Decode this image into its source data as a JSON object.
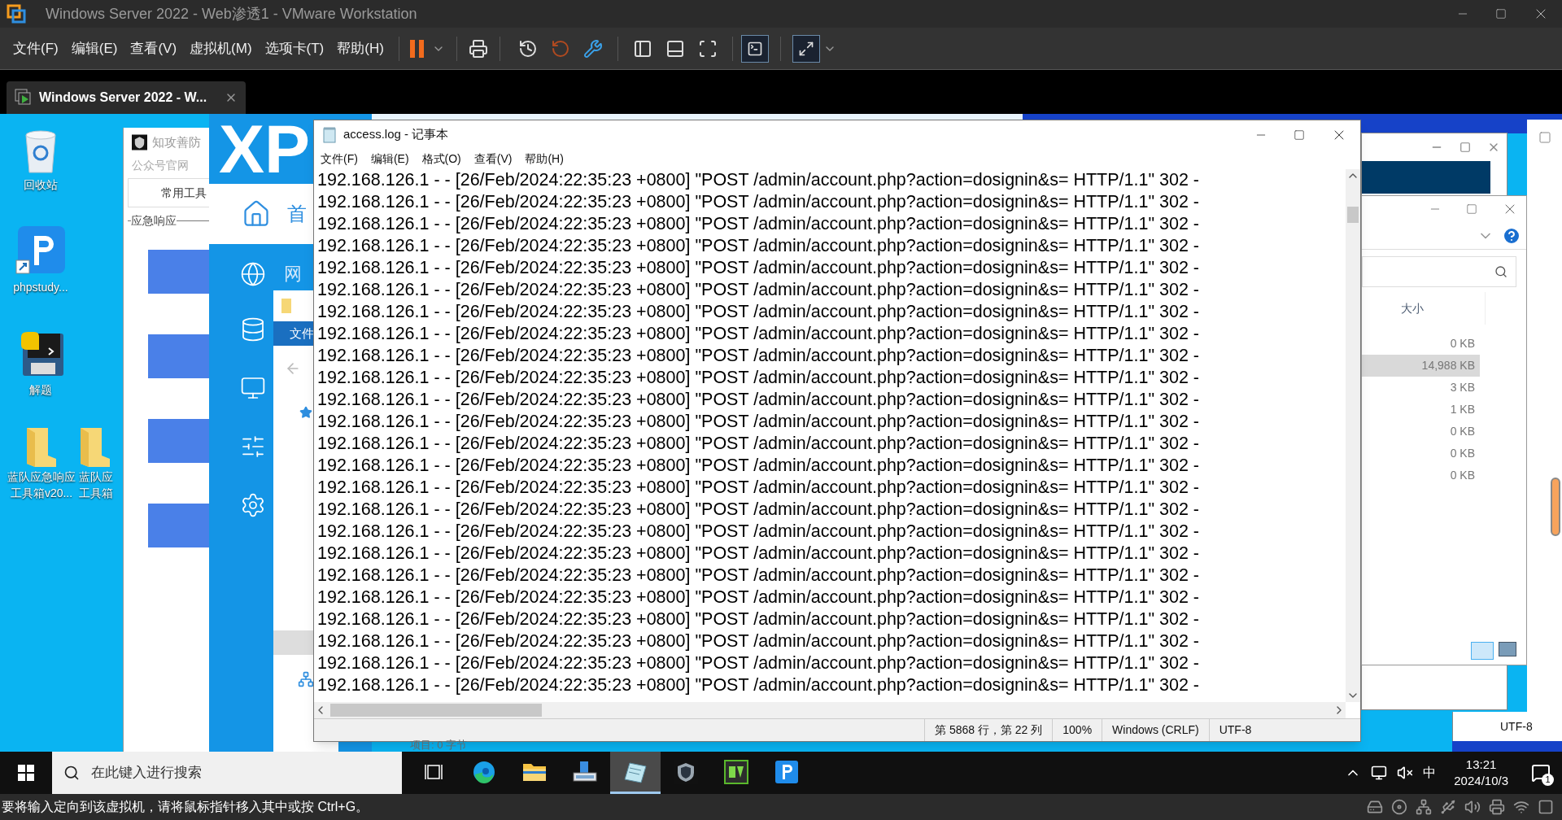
{
  "window": {
    "title": "Windows Server 2022 - Web渗透1 - VMware Workstation"
  },
  "menu": [
    "文件(F)",
    "编辑(E)",
    "查看(V)",
    "虚拟机(M)",
    "选项卡(T)",
    "帮助(H)"
  ],
  "vm_tab": {
    "label": "Windows Server 2022 - W...",
    "selected": true
  },
  "desktop_icons": [
    {
      "kind": "recycle",
      "lines": [
        "回收站"
      ]
    },
    {
      "kind": "phpstudy",
      "lines": [
        "phpstudy..."
      ]
    },
    {
      "kind": "python",
      "lines": [
        "解题"
      ]
    }
  ],
  "desktop_folders": [
    {
      "lines": [
        "蓝队应急响应",
        "工具箱v20..."
      ]
    },
    {
      "lines": [
        "蓝队应",
        "工具箱"
      ]
    }
  ],
  "toolkit_window": {
    "title": "知攻善防",
    "link": "公众号官网",
    "tab": "常用工具",
    "group": "应急响应"
  },
  "xp_window": {
    "logo": "XP",
    "home": "首",
    "nav": "网",
    "ribbon_tab": "文件"
  },
  "notepad": {
    "title": "access.log - 记事本",
    "menu": [
      "文件(F)",
      "编辑(E)",
      "格式(O)",
      "查看(V)",
      "帮助(H)"
    ],
    "lines": [
      "192.168.126.1 - - [26/Feb/2024:22:35:23 +0800] \"POST /admin/account.php?action=dosignin&s= HTTP/1.1\" 302 -",
      "192.168.126.1 - - [26/Feb/2024:22:35:23 +0800] \"POST /admin/account.php?action=dosignin&s= HTTP/1.1\" 302 -",
      "192.168.126.1 - - [26/Feb/2024:22:35:23 +0800] \"POST /admin/account.php?action=dosignin&s= HTTP/1.1\" 302 -",
      "192.168.126.1 - - [26/Feb/2024:22:35:23 +0800] \"POST /admin/account.php?action=dosignin&s= HTTP/1.1\" 302 -",
      "192.168.126.1 - - [26/Feb/2024:22:35:23 +0800] \"POST /admin/account.php?action=dosignin&s= HTTP/1.1\" 302 -",
      "192.168.126.1 - - [26/Feb/2024:22:35:23 +0800] \"POST /admin/account.php?action=dosignin&s= HTTP/1.1\" 302 -",
      "192.168.126.1 - - [26/Feb/2024:22:35:23 +0800] \"POST /admin/account.php?action=dosignin&s= HTTP/1.1\" 302 -",
      "192.168.126.1 - - [26/Feb/2024:22:35:23 +0800] \"POST /admin/account.php?action=dosignin&s= HTTP/1.1\" 302 -",
      "192.168.126.1 - - [26/Feb/2024:22:35:23 +0800] \"POST /admin/account.php?action=dosignin&s= HTTP/1.1\" 302 -",
      "192.168.126.1 - - [26/Feb/2024:22:35:23 +0800] \"POST /admin/account.php?action=dosignin&s= HTTP/1.1\" 302 -",
      "192.168.126.1 - - [26/Feb/2024:22:35:23 +0800] \"POST /admin/account.php?action=dosignin&s= HTTP/1.1\" 302 -",
      "192.168.126.1 - - [26/Feb/2024:22:35:23 +0800] \"POST /admin/account.php?action=dosignin&s= HTTP/1.1\" 302 -",
      "192.168.126.1 - - [26/Feb/2024:22:35:23 +0800] \"POST /admin/account.php?action=dosignin&s= HTTP/1.1\" 302 -",
      "192.168.126.1 - - [26/Feb/2024:22:35:23 +0800] \"POST /admin/account.php?action=dosignin&s= HTTP/1.1\" 302 -",
      "192.168.126.1 - - [26/Feb/2024:22:35:23 +0800] \"POST /admin/account.php?action=dosignin&s= HTTP/1.1\" 302 -",
      "192.168.126.1 - - [26/Feb/2024:22:35:23 +0800] \"POST /admin/account.php?action=dosignin&s= HTTP/1.1\" 302 -",
      "192.168.126.1 - - [26/Feb/2024:22:35:23 +0800] \"POST /admin/account.php?action=dosignin&s= HTTP/1.1\" 302 -",
      "192.168.126.1 - - [26/Feb/2024:22:35:23 +0800] \"POST /admin/account.php?action=dosignin&s= HTTP/1.1\" 302 -",
      "192.168.126.1 - - [26/Feb/2024:22:35:23 +0800] \"POST /admin/account.php?action=dosignin&s= HTTP/1.1\" 302 -",
      "192.168.126.1 - - [26/Feb/2024:22:35:23 +0800] \"POST /admin/account.php?action=dosignin&s= HTTP/1.1\" 302 -",
      "192.168.126.1 - - [26/Feb/2024:22:35:23 +0800] \"POST /admin/account.php?action=dosignin&s= HTTP/1.1\" 302 -",
      "192.168.126.1 - - [26/Feb/2024:22:35:23 +0800] \"POST /admin/account.php?action=dosignin&s= HTTP/1.1\" 302 -",
      "192.168.126.1 - - [26/Feb/2024:22:35:23 +0800] \"POST /admin/account.php?action=dosignin&s= HTTP/1.1\" 302 -",
      "192.168.126.1 - - [26/Feb/2024:22:35:23 +0800] \"POST /admin/account.php?action=dosignin&s= HTTP/1.1\" 302 -"
    ],
    "status": [
      "第 5868 行，第 22 列",
      "100%",
      "Windows (CRLF)",
      "UTF-8"
    ]
  },
  "explorer": {
    "column": "大小",
    "sizes": [
      {
        "text": "0 KB",
        "selected": false
      },
      {
        "text": "14,988 KB",
        "selected": true
      },
      {
        "text": "3 KB",
        "selected": false
      },
      {
        "text": "1 KB",
        "selected": false
      },
      {
        "text": "0 KB",
        "selected": false
      },
      {
        "text": "0 KB",
        "selected": false
      },
      {
        "text": "0 KB",
        "selected": false
      }
    ],
    "status": "项目: 0 字节"
  },
  "back_window": {
    "encoding": "UTF-8"
  },
  "taskbar": {
    "search_placeholder": "在此键入进行搜索",
    "apps": [
      {
        "kind": "taskview",
        "selected": false
      },
      {
        "kind": "edge",
        "selected": false
      },
      {
        "kind": "explorer",
        "selected": false
      },
      {
        "kind": "server",
        "selected": false
      },
      {
        "kind": "notepad",
        "selected": true
      },
      {
        "kind": "shield",
        "selected": false
      },
      {
        "kind": "green",
        "selected": false
      },
      {
        "kind": "phpstudy",
        "selected": false
      }
    ],
    "ime": "中",
    "time": "13:21",
    "date": "2024/10/3",
    "notifications": "1"
  },
  "status_bar": {
    "message": "要将输入定向到该虚拟机，请将鼠标指针移入其中或按 Ctrl+G。"
  }
}
